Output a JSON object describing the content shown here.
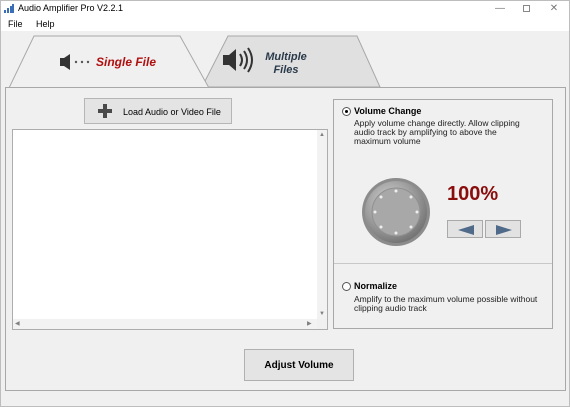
{
  "window": {
    "title": "Audio Amplifier Pro V2.2.1"
  },
  "menu": {
    "file": "File",
    "help": "Help"
  },
  "tabs": {
    "single": {
      "label": "Single File",
      "icon": "speaker-icon",
      "selected": true
    },
    "multiple": {
      "label_line1": "Multiple",
      "label_line2": "Files",
      "icon": "speaker-volume-icon"
    }
  },
  "load_button": {
    "label": "Load Audio or Video File",
    "icon": "plus-icon"
  },
  "file_list": {
    "items": []
  },
  "volume_change": {
    "title": "Volume Change",
    "selected": true,
    "desc_line1": "Apply volume change directly. Allow clipping",
    "desc_line2": "audio track by amplifying to above the",
    "desc_line3": "maximum volume",
    "percent": "100%",
    "knob_level": 1.0
  },
  "normalize": {
    "title": "Normalize",
    "selected": false,
    "desc_line1": "Amplify to the maximum volume possible without",
    "desc_line2": "clipping audio track"
  },
  "adjust_button": {
    "label": "Adjust Volume"
  },
  "colors": {
    "accent_red": "#b01010",
    "percent_red": "#8a0d0d",
    "panel_bg": "#f0f0f0"
  }
}
